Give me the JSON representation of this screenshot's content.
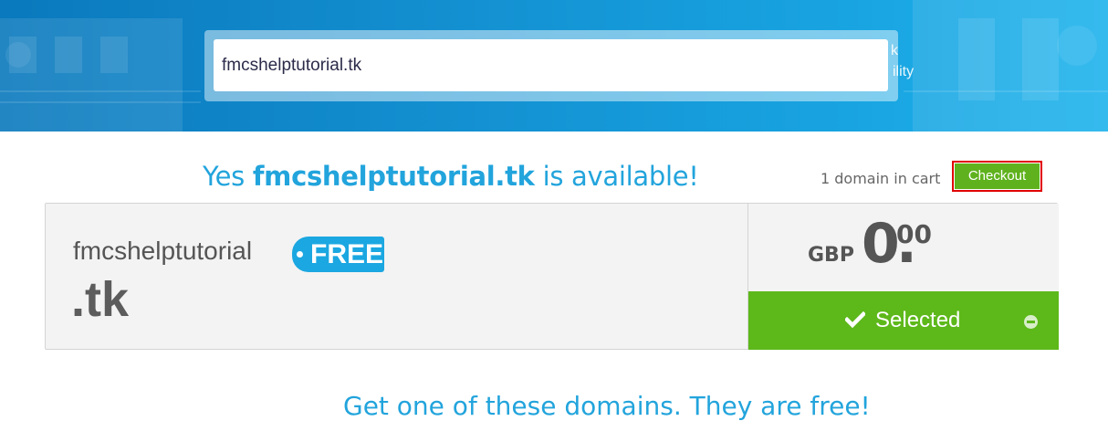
{
  "header": {
    "search": {
      "value": "fmcshelptutorial.tk",
      "placeholder": ""
    },
    "background_peek_lines": [
      "k",
      "ility"
    ]
  },
  "availability": {
    "prefix": "Yes ",
    "domain": "fmcshelptutorial.tk",
    "suffix": " is available!"
  },
  "cart": {
    "count_text": "1 domain in cart",
    "checkout_label": "Checkout"
  },
  "result": {
    "name": "fmcshelptutorial",
    "tld": ".tk",
    "badge": "FREE",
    "price": {
      "currency": "GBP",
      "integer": "0",
      "separator": ".",
      "decimal": "00"
    },
    "selected_label": "Selected",
    "check_icon": "check-icon",
    "remove_icon": "minus-circle-icon"
  },
  "bottom_text_partial": "Get one of these domains. They are free!",
  "colors": {
    "accent_blue": "#22a4dc",
    "badge_blue": "#1ba7e1",
    "success_green": "#5db81a",
    "checkout_green": "#5fb21d",
    "highlight_red": "#e00000"
  }
}
